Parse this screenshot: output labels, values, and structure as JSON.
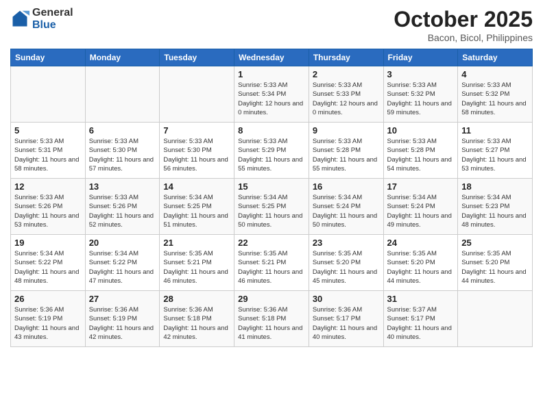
{
  "logo": {
    "general": "General",
    "blue": "Blue"
  },
  "header": {
    "month": "October 2025",
    "location": "Bacon, Bicol, Philippines"
  },
  "weekdays": [
    "Sunday",
    "Monday",
    "Tuesday",
    "Wednesday",
    "Thursday",
    "Friday",
    "Saturday"
  ],
  "weeks": [
    [
      {
        "day": "",
        "sunrise": "",
        "sunset": "",
        "daylight": ""
      },
      {
        "day": "",
        "sunrise": "",
        "sunset": "",
        "daylight": ""
      },
      {
        "day": "",
        "sunrise": "",
        "sunset": "",
        "daylight": ""
      },
      {
        "day": "1",
        "sunrise": "Sunrise: 5:33 AM",
        "sunset": "Sunset: 5:34 PM",
        "daylight": "Daylight: 12 hours and 0 minutes."
      },
      {
        "day": "2",
        "sunrise": "Sunrise: 5:33 AM",
        "sunset": "Sunset: 5:33 PM",
        "daylight": "Daylight: 12 hours and 0 minutes."
      },
      {
        "day": "3",
        "sunrise": "Sunrise: 5:33 AM",
        "sunset": "Sunset: 5:32 PM",
        "daylight": "Daylight: 11 hours and 59 minutes."
      },
      {
        "day": "4",
        "sunrise": "Sunrise: 5:33 AM",
        "sunset": "Sunset: 5:32 PM",
        "daylight": "Daylight: 11 hours and 58 minutes."
      }
    ],
    [
      {
        "day": "5",
        "sunrise": "Sunrise: 5:33 AM",
        "sunset": "Sunset: 5:31 PM",
        "daylight": "Daylight: 11 hours and 58 minutes."
      },
      {
        "day": "6",
        "sunrise": "Sunrise: 5:33 AM",
        "sunset": "Sunset: 5:30 PM",
        "daylight": "Daylight: 11 hours and 57 minutes."
      },
      {
        "day": "7",
        "sunrise": "Sunrise: 5:33 AM",
        "sunset": "Sunset: 5:30 PM",
        "daylight": "Daylight: 11 hours and 56 minutes."
      },
      {
        "day": "8",
        "sunrise": "Sunrise: 5:33 AM",
        "sunset": "Sunset: 5:29 PM",
        "daylight": "Daylight: 11 hours and 55 minutes."
      },
      {
        "day": "9",
        "sunrise": "Sunrise: 5:33 AM",
        "sunset": "Sunset: 5:28 PM",
        "daylight": "Daylight: 11 hours and 55 minutes."
      },
      {
        "day": "10",
        "sunrise": "Sunrise: 5:33 AM",
        "sunset": "Sunset: 5:28 PM",
        "daylight": "Daylight: 11 hours and 54 minutes."
      },
      {
        "day": "11",
        "sunrise": "Sunrise: 5:33 AM",
        "sunset": "Sunset: 5:27 PM",
        "daylight": "Daylight: 11 hours and 53 minutes."
      }
    ],
    [
      {
        "day": "12",
        "sunrise": "Sunrise: 5:33 AM",
        "sunset": "Sunset: 5:26 PM",
        "daylight": "Daylight: 11 hours and 53 minutes."
      },
      {
        "day": "13",
        "sunrise": "Sunrise: 5:33 AM",
        "sunset": "Sunset: 5:26 PM",
        "daylight": "Daylight: 11 hours and 52 minutes."
      },
      {
        "day": "14",
        "sunrise": "Sunrise: 5:34 AM",
        "sunset": "Sunset: 5:25 PM",
        "daylight": "Daylight: 11 hours and 51 minutes."
      },
      {
        "day": "15",
        "sunrise": "Sunrise: 5:34 AM",
        "sunset": "Sunset: 5:25 PM",
        "daylight": "Daylight: 11 hours and 50 minutes."
      },
      {
        "day": "16",
        "sunrise": "Sunrise: 5:34 AM",
        "sunset": "Sunset: 5:24 PM",
        "daylight": "Daylight: 11 hours and 50 minutes."
      },
      {
        "day": "17",
        "sunrise": "Sunrise: 5:34 AM",
        "sunset": "Sunset: 5:24 PM",
        "daylight": "Daylight: 11 hours and 49 minutes."
      },
      {
        "day": "18",
        "sunrise": "Sunrise: 5:34 AM",
        "sunset": "Sunset: 5:23 PM",
        "daylight": "Daylight: 11 hours and 48 minutes."
      }
    ],
    [
      {
        "day": "19",
        "sunrise": "Sunrise: 5:34 AM",
        "sunset": "Sunset: 5:22 PM",
        "daylight": "Daylight: 11 hours and 48 minutes."
      },
      {
        "day": "20",
        "sunrise": "Sunrise: 5:34 AM",
        "sunset": "Sunset: 5:22 PM",
        "daylight": "Daylight: 11 hours and 47 minutes."
      },
      {
        "day": "21",
        "sunrise": "Sunrise: 5:35 AM",
        "sunset": "Sunset: 5:21 PM",
        "daylight": "Daylight: 11 hours and 46 minutes."
      },
      {
        "day": "22",
        "sunrise": "Sunrise: 5:35 AM",
        "sunset": "Sunset: 5:21 PM",
        "daylight": "Daylight: 11 hours and 46 minutes."
      },
      {
        "day": "23",
        "sunrise": "Sunrise: 5:35 AM",
        "sunset": "Sunset: 5:20 PM",
        "daylight": "Daylight: 11 hours and 45 minutes."
      },
      {
        "day": "24",
        "sunrise": "Sunrise: 5:35 AM",
        "sunset": "Sunset: 5:20 PM",
        "daylight": "Daylight: 11 hours and 44 minutes."
      },
      {
        "day": "25",
        "sunrise": "Sunrise: 5:35 AM",
        "sunset": "Sunset: 5:20 PM",
        "daylight": "Daylight: 11 hours and 44 minutes."
      }
    ],
    [
      {
        "day": "26",
        "sunrise": "Sunrise: 5:36 AM",
        "sunset": "Sunset: 5:19 PM",
        "daylight": "Daylight: 11 hours and 43 minutes."
      },
      {
        "day": "27",
        "sunrise": "Sunrise: 5:36 AM",
        "sunset": "Sunset: 5:19 PM",
        "daylight": "Daylight: 11 hours and 42 minutes."
      },
      {
        "day": "28",
        "sunrise": "Sunrise: 5:36 AM",
        "sunset": "Sunset: 5:18 PM",
        "daylight": "Daylight: 11 hours and 42 minutes."
      },
      {
        "day": "29",
        "sunrise": "Sunrise: 5:36 AM",
        "sunset": "Sunset: 5:18 PM",
        "daylight": "Daylight: 11 hours and 41 minutes."
      },
      {
        "day": "30",
        "sunrise": "Sunrise: 5:36 AM",
        "sunset": "Sunset: 5:17 PM",
        "daylight": "Daylight: 11 hours and 40 minutes."
      },
      {
        "day": "31",
        "sunrise": "Sunrise: 5:37 AM",
        "sunset": "Sunset: 5:17 PM",
        "daylight": "Daylight: 11 hours and 40 minutes."
      },
      {
        "day": "",
        "sunrise": "",
        "sunset": "",
        "daylight": ""
      }
    ]
  ]
}
